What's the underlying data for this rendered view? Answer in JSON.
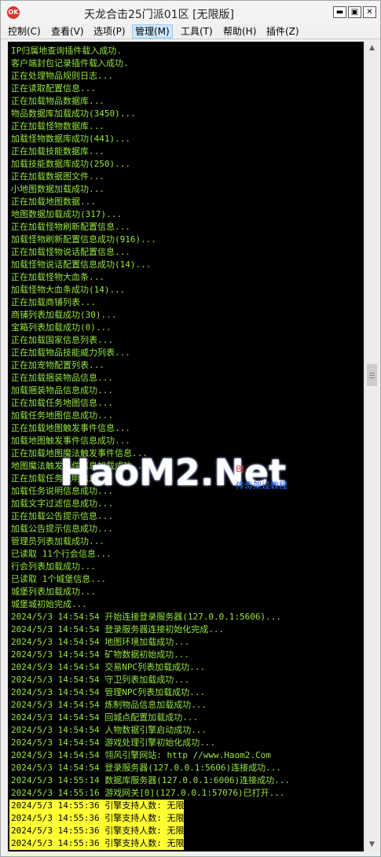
{
  "window": {
    "icon_text": "OK",
    "title": "天龙合击25门派01区 [无限版]",
    "minimize": "▬",
    "maximize": "▣",
    "close": "✕"
  },
  "menu": [
    {
      "label": "控制(C)"
    },
    {
      "label": "查看(V)"
    },
    {
      "label": "选项(P)"
    },
    {
      "label": "管理(M)",
      "active": true
    },
    {
      "label": "工具(T)"
    },
    {
      "label": "帮助(H)"
    },
    {
      "label": "插件(Z)"
    }
  ],
  "log": [
    {
      "text": "IP归属地查询插件载入成功."
    },
    {
      "text": "客户端封包记录插件载入成功."
    },
    {
      "text": "正在处理物品规则日志..."
    },
    {
      "text": "正在读取配置信息..."
    },
    {
      "text": "正在加载物品数据库..."
    },
    {
      "text": "物品数据库加载成功(3450)..."
    },
    {
      "text": "正在加载怪物数据库..."
    },
    {
      "text": "加载怪物数据库成功(441)..."
    },
    {
      "text": "正在加载技能数据库..."
    },
    {
      "text": "加载技能数据库成功(250)..."
    },
    {
      "text": "正在加载数据图文件..."
    },
    {
      "text": "小地图数据加载成功..."
    },
    {
      "text": "正在加载地图数据..."
    },
    {
      "text": "地图数据加载成功(317)..."
    },
    {
      "text": "正在加载怪物刷新配置信息..."
    },
    {
      "text": "加载怪物刷新配置信息成功(916)..."
    },
    {
      "text": "正在加载怪物说话配置信息..."
    },
    {
      "text": "加载怪物说话配置信息成功(14)..."
    },
    {
      "text": "正在加载怪物大血条..."
    },
    {
      "text": "加载怪物大血条成功(14)..."
    },
    {
      "text": "正在加载商铺列表..."
    },
    {
      "text": "商铺列表加载成功(30)..."
    },
    {
      "text": "宝箱列表加载成功(0)..."
    },
    {
      "text": "正在加载国家信息列表..."
    },
    {
      "text": "正在加载物品技能威力列表..."
    },
    {
      "text": "正在加宠物配置列表..."
    },
    {
      "text": "正在加载捆装物品信息..."
    },
    {
      "text": "加载捆装物品信息成功..."
    },
    {
      "text": "正在加载任务地图信息..."
    },
    {
      "text": "加载任务地图信息成功..."
    },
    {
      "text": "正在加载地图触发事件信息..."
    },
    {
      "text": "加载地图触发事件信息成功..."
    },
    {
      "text": "正在加载地图魔法触发事件信息..."
    },
    {
      "text": "地图魔法触发事件信息加载成功..."
    },
    {
      "text": "正在加载任务说明信息..."
    },
    {
      "text": "加载任务说明信息成功..."
    },
    {
      "text": "加载文字过滤信息成功..."
    },
    {
      "text": "正在加载公告提示信息..."
    },
    {
      "text": "加载公告提示信息成功..."
    },
    {
      "text": "管理员列表加载成功..."
    },
    {
      "text": "已读取 11个行会信息..."
    },
    {
      "text": "行会列表加载成功..."
    },
    {
      "text": "已读取 1个城堡信息..."
    },
    {
      "text": "城堡列表加载成功..."
    },
    {
      "text": "城堡城初始完成..."
    },
    {
      "text": "2024/5/3 14:54:54 开始连接登录服务器(127.0.0.1:5606)..."
    },
    {
      "text": "2024/5/3 14:54:54 登录服务器连接初始化完成..."
    },
    {
      "text": "2024/5/3 14:54:54 地图环境加载成功..."
    },
    {
      "text": "2024/5/3 14:54:54 矿物数据初始成功..."
    },
    {
      "text": "2024/5/3 14:54:54 交易NPC列表加载成功..."
    },
    {
      "text": "2024/5/3 14:54:54 守卫列表加载成功..."
    },
    {
      "text": "2024/5/3 14:54:54 管理NPC列表加载成功..."
    },
    {
      "text": "2024/5/3 14:54:54 炼制物品信息加载成功..."
    },
    {
      "text": "2024/5/3 14:54:54 回城点配置加载成功..."
    },
    {
      "text": "2024/5/3 14:54:54 人物数据引擎启动成功..."
    },
    {
      "text": "2024/5/3 14:54:54 游戏处理引擎初始化成功..."
    },
    {
      "text": "2024/5/3 14:54:54 翎风引擎网站: http //www.Haom2.Com"
    },
    {
      "text": "2024/5/3 14:54:54 登录服务器(127.0.0.1:5606)连接成功..."
    },
    {
      "text": "2024/5/3 14:55:14 数据库服务器(127.0.0.1:6006)连接成功..."
    },
    {
      "text": "2024/5/3 14:55:16 游戏网关[0](127.0.0.1:57076)已打开..."
    },
    {
      "text": "2024/5/3 14:55:36 引擎支持人数: 无限",
      "highlight": true
    },
    {
      "text": "2024/5/3 14:55:36 引擎支持人数: 无限",
      "highlight": true
    },
    {
      "text": "2024/5/3 14:55:36 引擎支持人数: 无限",
      "highlight": true
    },
    {
      "text": "2024/5/3 14:55:36 引擎支持人数: 无限",
      "highlight": true
    }
  ],
  "watermark": {
    "main": "HaoM2.Net",
    "sub1": "BJ",
    "sub2": "传奇架设教程"
  },
  "scrollbar": {
    "up_arrow": "▲",
    "down_arrow": "▼"
  }
}
